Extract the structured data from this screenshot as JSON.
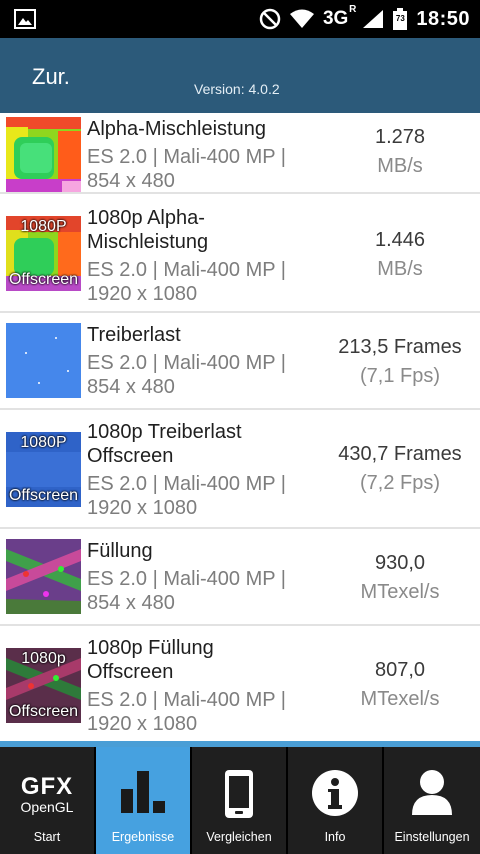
{
  "status_bar": {
    "network": "3G",
    "network_sup": "R",
    "battery": "73",
    "time": "18:50"
  },
  "header": {
    "back_label": "Zur.",
    "version": "Version: 4.0.2"
  },
  "results": [
    {
      "name": "Alpha-Mischleistung",
      "api": "ES 2.0 | Mali-400 MP |",
      "resolution": "854 x 480",
      "value": "1.278",
      "unit": "MB/s",
      "thumb_top": "",
      "thumb_bottom": ""
    },
    {
      "name_line1": "1080p Alpha-",
      "name_line2": "Mischleistung",
      "api": "ES 2.0 | Mali-400 MP |",
      "resolution": "1920 x 1080",
      "value": "1.446",
      "unit": "MB/s",
      "thumb_top": "1080P",
      "thumb_bottom": "Offscreen"
    },
    {
      "name": "Treiberlast",
      "api": "ES 2.0 | Mali-400 MP |",
      "resolution": "854 x 480",
      "value": "213,5 Frames",
      "unit": "(7,1 Fps)"
    },
    {
      "name_line1": "1080p Treiberlast",
      "name_line2": "Offscreen",
      "api": "ES 2.0 | Mali-400 MP |",
      "resolution": "1920 x 1080",
      "value": "430,7 Frames",
      "unit": "(7,2 Fps)",
      "thumb_top": "1080P",
      "thumb_bottom": "Offscreen"
    },
    {
      "name": "Füllung",
      "api": "ES 2.0 | Mali-400 MP |",
      "resolution": "854 x 480",
      "value": "930,0",
      "unit": "MTexel/s"
    },
    {
      "name_line1": "1080p Füllung",
      "name_line2": "Offscreen",
      "api": "ES 2.0 | Mali-400 MP |",
      "resolution": "1920 x 1080",
      "value": "807,0",
      "unit": "MTexel/s",
      "thumb_top": "1080p",
      "thumb_bottom": "Offscreen"
    }
  ],
  "nav": {
    "logo_top": "GFX",
    "logo_bottom": "OpenGL",
    "items": [
      {
        "label": "Start",
        "icon": "gfx-logo-icon"
      },
      {
        "label": "Ergebnisse",
        "icon": "bar-chart-icon"
      },
      {
        "label": "Vergleichen",
        "icon": "phone-icon"
      },
      {
        "label": "Info",
        "icon": "info-icon"
      },
      {
        "label": "Einstellungen",
        "icon": "user-icon"
      }
    ],
    "active_index": 1
  },
  "colors": {
    "header_bg": "#2c5a7a",
    "nav_bg": "#1f1f1f",
    "nav_active": "#46a1e0"
  }
}
